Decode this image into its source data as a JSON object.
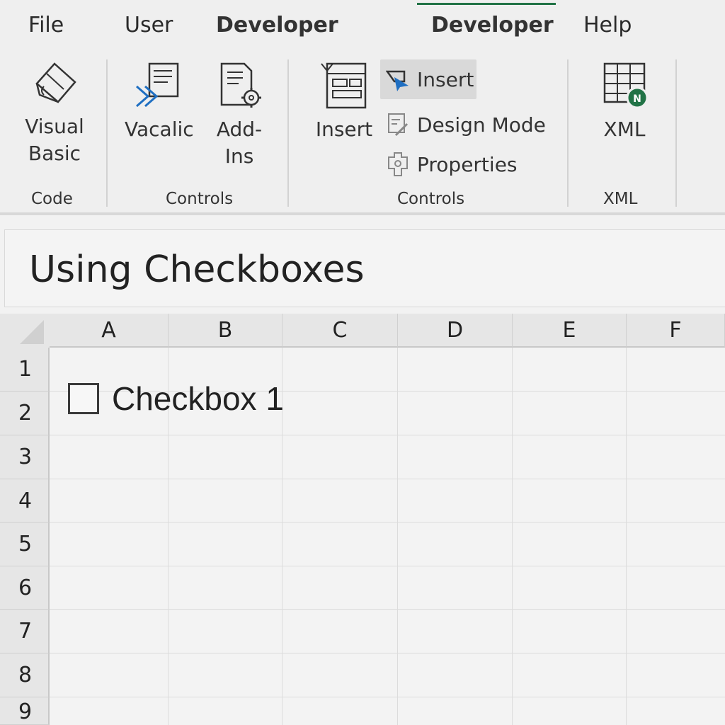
{
  "menu": {
    "tabs": [
      {
        "label": "File"
      },
      {
        "label": "User"
      },
      {
        "label": "Developer"
      },
      {
        "label": "Developer"
      },
      {
        "label": "Help"
      }
    ]
  },
  "ribbon": {
    "code_group": {
      "visual_basic_label_1": "Visual",
      "visual_basic_label_2": "Basic",
      "label": "Code"
    },
    "controls_group_1": {
      "vacalic_label": "Vacalic",
      "addins_label_1": "Add-",
      "addins_label_2": "Ins",
      "label": "Controls"
    },
    "controls_group_2": {
      "insert_large_label": "Insert",
      "insert_small_label": "Insert",
      "design_mode_label": "Design Mode",
      "properties_label": "Properties",
      "label": "Controls"
    },
    "xml_group": {
      "xml_label": "XML",
      "label": "XML"
    }
  },
  "sheet": {
    "title": "Using Checkboxes",
    "columns": [
      "A",
      "B",
      "C",
      "D",
      "E",
      "F"
    ],
    "rows": [
      "1",
      "2",
      "3",
      "4",
      "5",
      "6",
      "7",
      "8",
      "9"
    ],
    "checkbox": {
      "label": "Checkbox 1",
      "checked": false
    }
  },
  "colors": {
    "accent": "#217346",
    "insert_arrow": "#1f6fc2"
  }
}
